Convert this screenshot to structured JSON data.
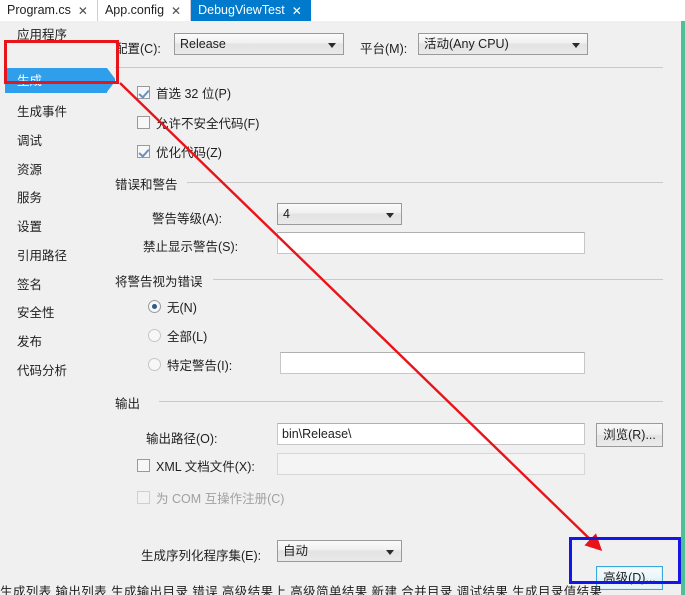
{
  "window": {
    "tabs": [
      {
        "label": "Program.cs",
        "close": "✕",
        "active": false
      },
      {
        "label": "App.config",
        "close": "✕",
        "active": false
      },
      {
        "label": "DebugViewTest",
        "close": "✕",
        "active": true
      }
    ]
  },
  "sidebar": {
    "items": [
      {
        "label": "应用程序",
        "selected": false
      },
      {
        "label": "生成",
        "selected": true
      },
      {
        "label": "生成事件",
        "selected": false
      },
      {
        "label": "调试",
        "selected": false
      },
      {
        "label": "资源",
        "selected": false
      },
      {
        "label": "服务",
        "selected": false
      },
      {
        "label": "设置",
        "selected": false
      },
      {
        "label": "引用路径",
        "selected": false
      },
      {
        "label": "签名",
        "selected": false
      },
      {
        "label": "安全性",
        "selected": false
      },
      {
        "label": "发布",
        "selected": false
      },
      {
        "label": "代码分析",
        "selected": false
      }
    ]
  },
  "config_row": {
    "configuration_label": "配置(C):",
    "configuration_value": "Release",
    "platform_label": "平台(M):",
    "platform_value": "活动(Any CPU)"
  },
  "general": {
    "prefer32_label": "首选 32 位(P)",
    "prefer32_checked": true,
    "unsafe_label": "允许不安全代码(F)",
    "unsafe_checked": false,
    "optimize_label": "优化代码(Z)",
    "optimize_checked": true
  },
  "errors_warnings": {
    "group_title": "错误和警告",
    "warning_level_label": "警告等级(A):",
    "warning_level_value": "4",
    "suppress_label": "禁止显示警告(S):",
    "suppress_value": ""
  },
  "treat_warnings": {
    "group_title": "将警告视为错误",
    "none_label": "无(N)",
    "none_selected": true,
    "all_label": "全部(L)",
    "all_selected": false,
    "specific_label": "特定警告(I):",
    "specific_selected": false,
    "specific_value": ""
  },
  "output": {
    "group_title": "输出",
    "path_label": "输出路径(O):",
    "path_value": "bin\\Release\\",
    "browse_label": "浏览(R)...",
    "xml_label": "XML 文档文件(X):",
    "xml_checked": false,
    "xml_value": "",
    "com_label": "为 COM 互操作注册(C)",
    "com_checked": false,
    "serialization_label": "生成序列化程序集(E):",
    "serialization_value": "自动",
    "advanced_label": "高级(D)..."
  },
  "status_strip": {
    "text": "生成列表  输出列表  生成输出目录  错误  高级结果上  高级简单结果  新建  合并目录  调试结果  生成目录值结果"
  },
  "annotations": {
    "red_box_target": "sidebar-item-build",
    "blue_box_target": "advanced-button",
    "red_color": "#e8141a",
    "blue_color": "#1416e8"
  },
  "theme": {
    "active_tab_bg": "#007acc",
    "selection_blue": "#2f9fec",
    "panel_bg": "#f0f0f0",
    "right_edge": "#4dbf99"
  }
}
